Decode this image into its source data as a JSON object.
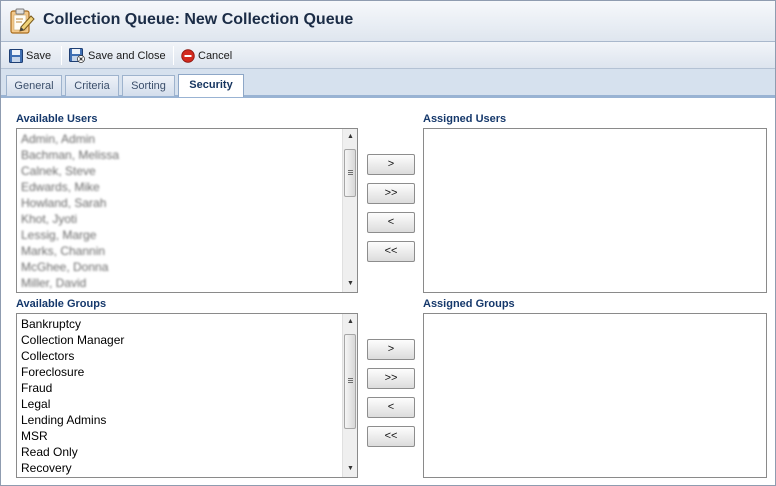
{
  "window": {
    "title": "Collection Queue: New Collection Queue"
  },
  "toolbar": {
    "save_label": "Save",
    "save_close_label": "Save and Close",
    "cancel_label": "Cancel"
  },
  "tabs": [
    {
      "label": "General"
    },
    {
      "label": "Criteria"
    },
    {
      "label": "Sorting"
    },
    {
      "label": "Security"
    }
  ],
  "active_tab": "Security",
  "users": {
    "available_label": "Available Users",
    "assigned_label": "Assigned Users",
    "available": [
      "Admin, Admin",
      "Bachman, Melissa",
      "Calnek, Steve",
      "Edwards, Mike",
      "Howland, Sarah",
      "Khot, Jyoti",
      "Lessig, Marge",
      "Marks, Channin",
      "McGhee, Donna",
      "Miller, David"
    ],
    "assigned": []
  },
  "groups": {
    "available_label": "Available Groups",
    "assigned_label": "Assigned Groups",
    "available": [
      "Bankruptcy",
      "Collection Manager",
      "Collectors",
      "Foreclosure",
      "Fraud",
      "Legal",
      "Lending Admins",
      "MSR",
      "Read Only",
      "Recovery"
    ],
    "assigned": []
  },
  "move_buttons": {
    "add": ">",
    "add_all": ">>",
    "remove": "<",
    "remove_all": "<<"
  },
  "icons": {
    "title": "clipboard-edit-icon",
    "save": "floppy-disk-icon",
    "save_close": "floppy-disk-close-icon",
    "cancel": "cancel-circle-icon"
  },
  "colors": {
    "section_label": "#15386b",
    "tab_active_text": "#15345f",
    "cancel_red": "#d22a1e"
  }
}
